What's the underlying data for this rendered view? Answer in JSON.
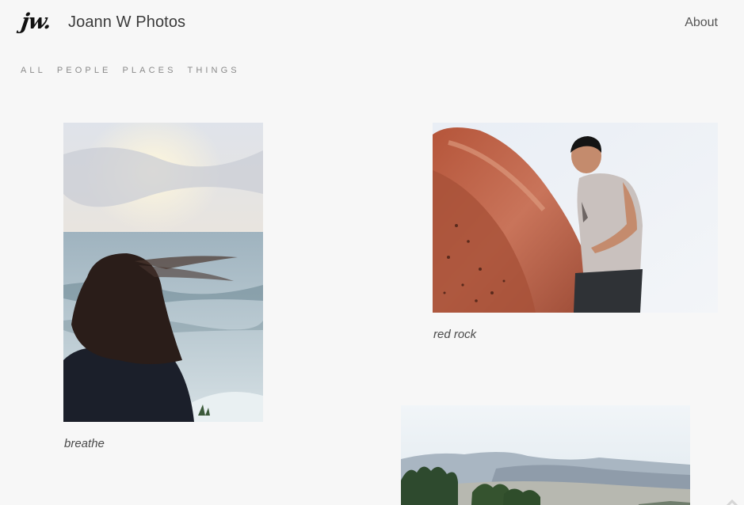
{
  "header": {
    "logo_text": "jw.",
    "site_title": "Joann W Photos",
    "nav_about": "About"
  },
  "filters": [
    "ALL",
    "PEOPLE",
    "PLACES",
    "THINGS"
  ],
  "photos": [
    {
      "caption": "breathe"
    },
    {
      "caption": "red rock"
    },
    {
      "caption": ""
    }
  ],
  "icons": {
    "logo": "jw-logo-icon",
    "scroll_top": "chevron-up-icon"
  }
}
